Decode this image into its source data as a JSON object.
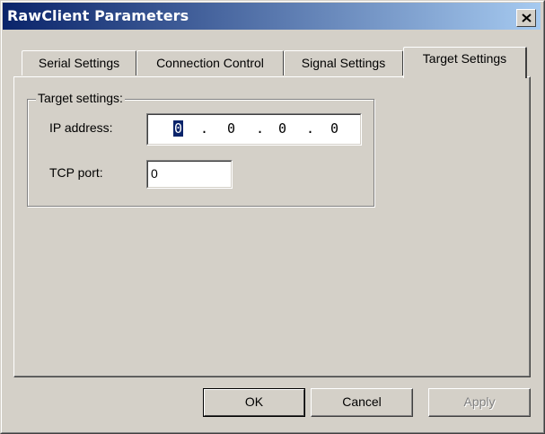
{
  "window": {
    "title": "RawClient Parameters"
  },
  "tabs": [
    {
      "label": "Serial Settings",
      "active": false
    },
    {
      "label": "Connection Control",
      "active": false
    },
    {
      "label": "Signal Settings",
      "active": false
    },
    {
      "label": "Target Settings",
      "active": true
    }
  ],
  "target_settings": {
    "group_label": "Target settings:",
    "ip_label": "IP address:",
    "ip_octets": [
      "0",
      "0",
      "0",
      "0"
    ],
    "ip_separator": ".",
    "tcp_label": "TCP port:",
    "tcp_value": "0"
  },
  "buttons": {
    "ok": "OK",
    "cancel": "Cancel",
    "apply": "Apply"
  },
  "colors": {
    "titlebar_start": "#0a246a",
    "titlebar_end": "#a6caf0",
    "face": "#d4d0c8"
  },
  "icons": {
    "close": "close-icon"
  }
}
